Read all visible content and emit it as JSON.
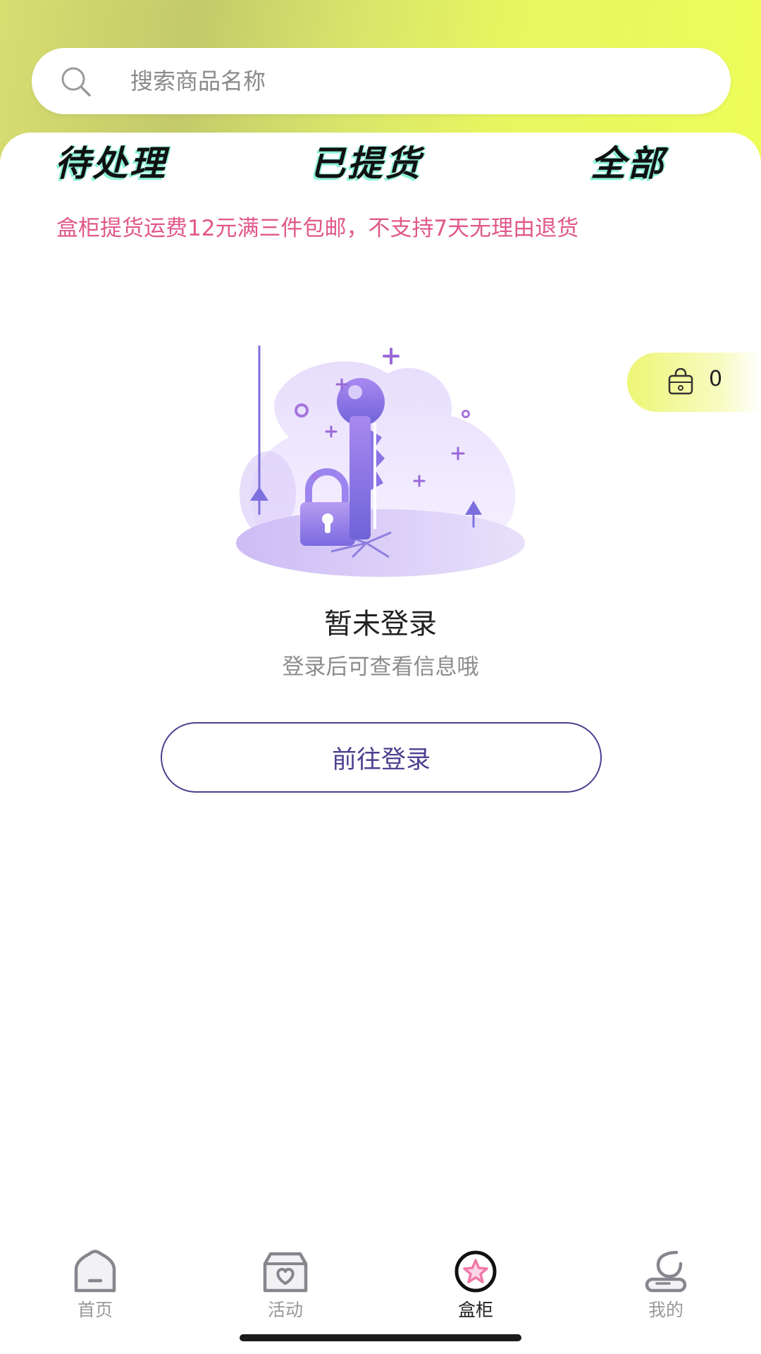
{
  "search": {
    "placeholder": "搜索商品名称",
    "icon": "search-icon"
  },
  "tabs": [
    {
      "label": "待处理",
      "active": true
    },
    {
      "label": "已提货",
      "active": false
    },
    {
      "label": "全部",
      "active": false
    }
  ],
  "notice": "盒柜提货运费12元满三件包邮，不支持7天无理由退货",
  "box_counter": {
    "icon": "bag-icon",
    "count": "0"
  },
  "empty_state": {
    "illustration": "key-and-lock-illustration",
    "title": "暂未登录",
    "description": "登录后可查看信息哦",
    "button_label": "前往登录"
  },
  "bottom_nav": [
    {
      "label": "首页",
      "icon": "home-icon",
      "active": false
    },
    {
      "label": "活动",
      "icon": "gift-box-heart-icon",
      "active": false
    },
    {
      "label": "盒柜",
      "icon": "star-circle-icon",
      "active": true
    },
    {
      "label": "我的",
      "icon": "profile-icon",
      "active": false
    }
  ],
  "colors": {
    "accent": "#4d3f8f",
    "notice": "#e0588a",
    "header_gradient_start": "#c3ca6a",
    "header_gradient_end": "#eefc5a",
    "tab_shadow": "#8ff3d8"
  }
}
